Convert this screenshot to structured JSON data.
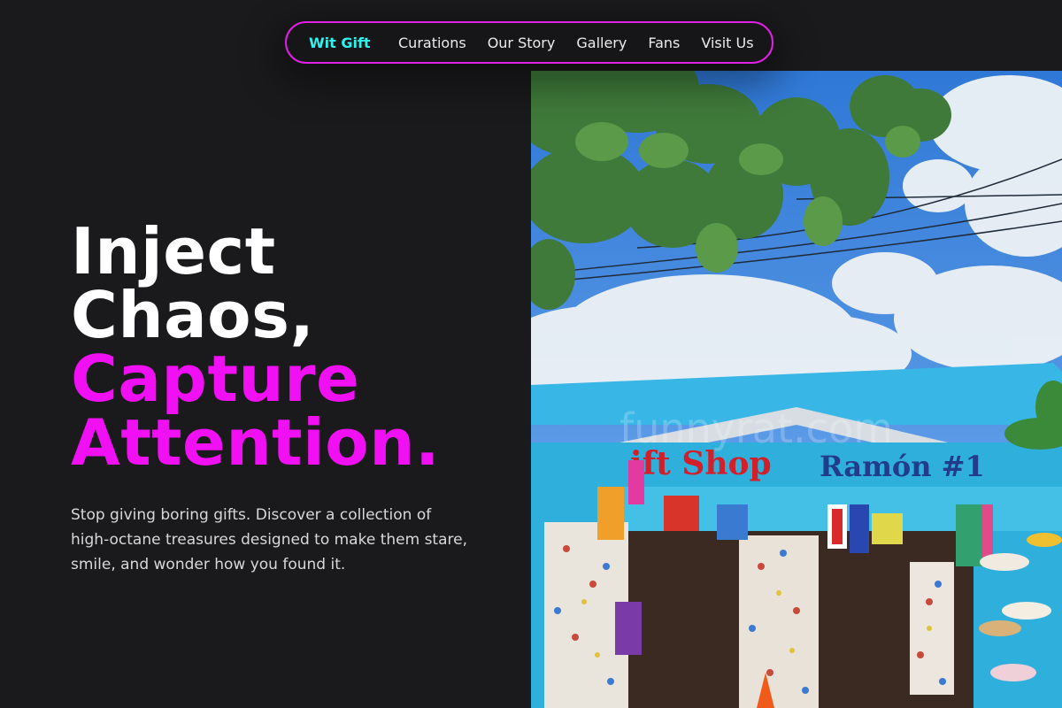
{
  "nav": {
    "brand": "Wit Gift",
    "links": [
      "Curations",
      "Our Story",
      "Gallery",
      "Fans",
      "Visit Us"
    ]
  },
  "hero": {
    "headline_lines": [
      "Inject",
      "Chaos,",
      "Capture",
      "Attention."
    ],
    "subtext": "Stop giving boring gifts. Discover a collection of high-octane treasures designed to make them stare, smile, and wonder how you found it."
  },
  "photo": {
    "sign_left": "ift Shop",
    "sign_right": "Ramón #1",
    "watermark": "funnyrat.com"
  },
  "colors": {
    "background": "#1a191b",
    "brand": "#2ff2ee",
    "accent": "#f010f3",
    "nav_border": "#e020e6"
  }
}
